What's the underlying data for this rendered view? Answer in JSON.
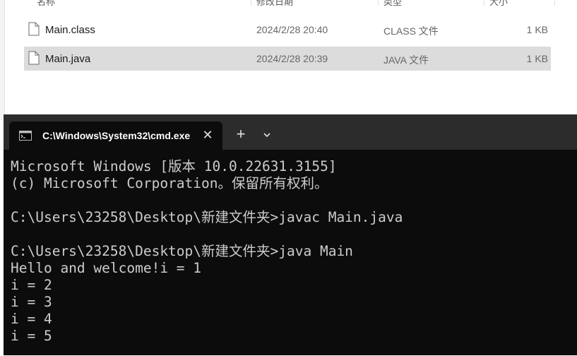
{
  "explorer": {
    "columns": {
      "name": "名称",
      "modified": "修改日期",
      "type": "类型",
      "size": "大小"
    },
    "files": [
      {
        "name": "Main.class",
        "modified": "2024/2/28 20:40",
        "type": "CLASS 文件",
        "size": "1 KB"
      },
      {
        "name": "Main.java",
        "modified": "2024/2/28 20:39",
        "type": "JAVA 文件",
        "size": "1 KB"
      }
    ]
  },
  "terminal": {
    "tab_title": "C:\\Windows\\System32\\cmd.exe",
    "tab_icon": "cmd-icon",
    "lines": [
      "Microsoft Windows [版本 10.0.22631.3155]",
      "(c) Microsoft Corporation。保留所有权利。",
      "",
      "C:\\Users\\23258\\Desktop\\新建文件夹>javac Main.java",
      "",
      "C:\\Users\\23258\\Desktop\\新建文件夹>java Main",
      "Hello and welcome!i = 1",
      "i = 2",
      "i = 3",
      "i = 4",
      "i = 5"
    ]
  }
}
